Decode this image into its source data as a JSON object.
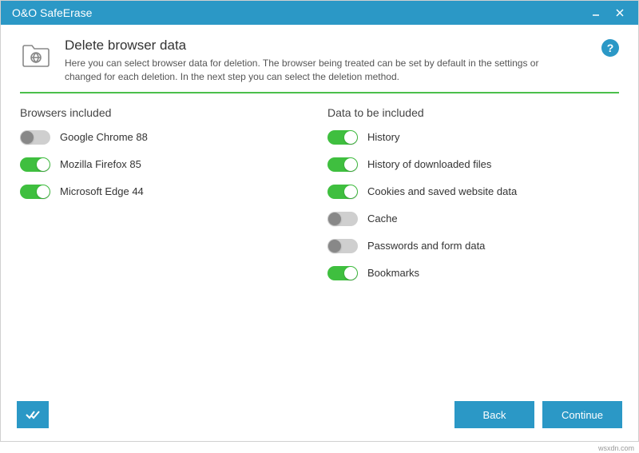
{
  "titlebar": {
    "app_name": "O&O SafeErase"
  },
  "header": {
    "title": "Delete browser data",
    "description": "Here you can select browser data for deletion. The browser being treated can be set by default in the settings or changed for each deletion. In the next step you can select the deletion method."
  },
  "columns": {
    "browsers": {
      "title": "Browsers included",
      "items": [
        {
          "label": "Google Chrome 88",
          "on": false
        },
        {
          "label": "Mozilla Firefox 85",
          "on": true
        },
        {
          "label": "Microsoft Edge 44",
          "on": true
        }
      ]
    },
    "data": {
      "title": "Data to be included",
      "items": [
        {
          "label": "History",
          "on": true
        },
        {
          "label": "History of downloaded files",
          "on": true
        },
        {
          "label": "Cookies and saved website data",
          "on": true
        },
        {
          "label": "Cache",
          "on": false
        },
        {
          "label": "Passwords and form data",
          "on": false
        },
        {
          "label": "Bookmarks",
          "on": true
        }
      ]
    }
  },
  "footer": {
    "back_label": "Back",
    "continue_label": "Continue"
  },
  "help_glyph": "?",
  "watermark": "wsxdn.com"
}
